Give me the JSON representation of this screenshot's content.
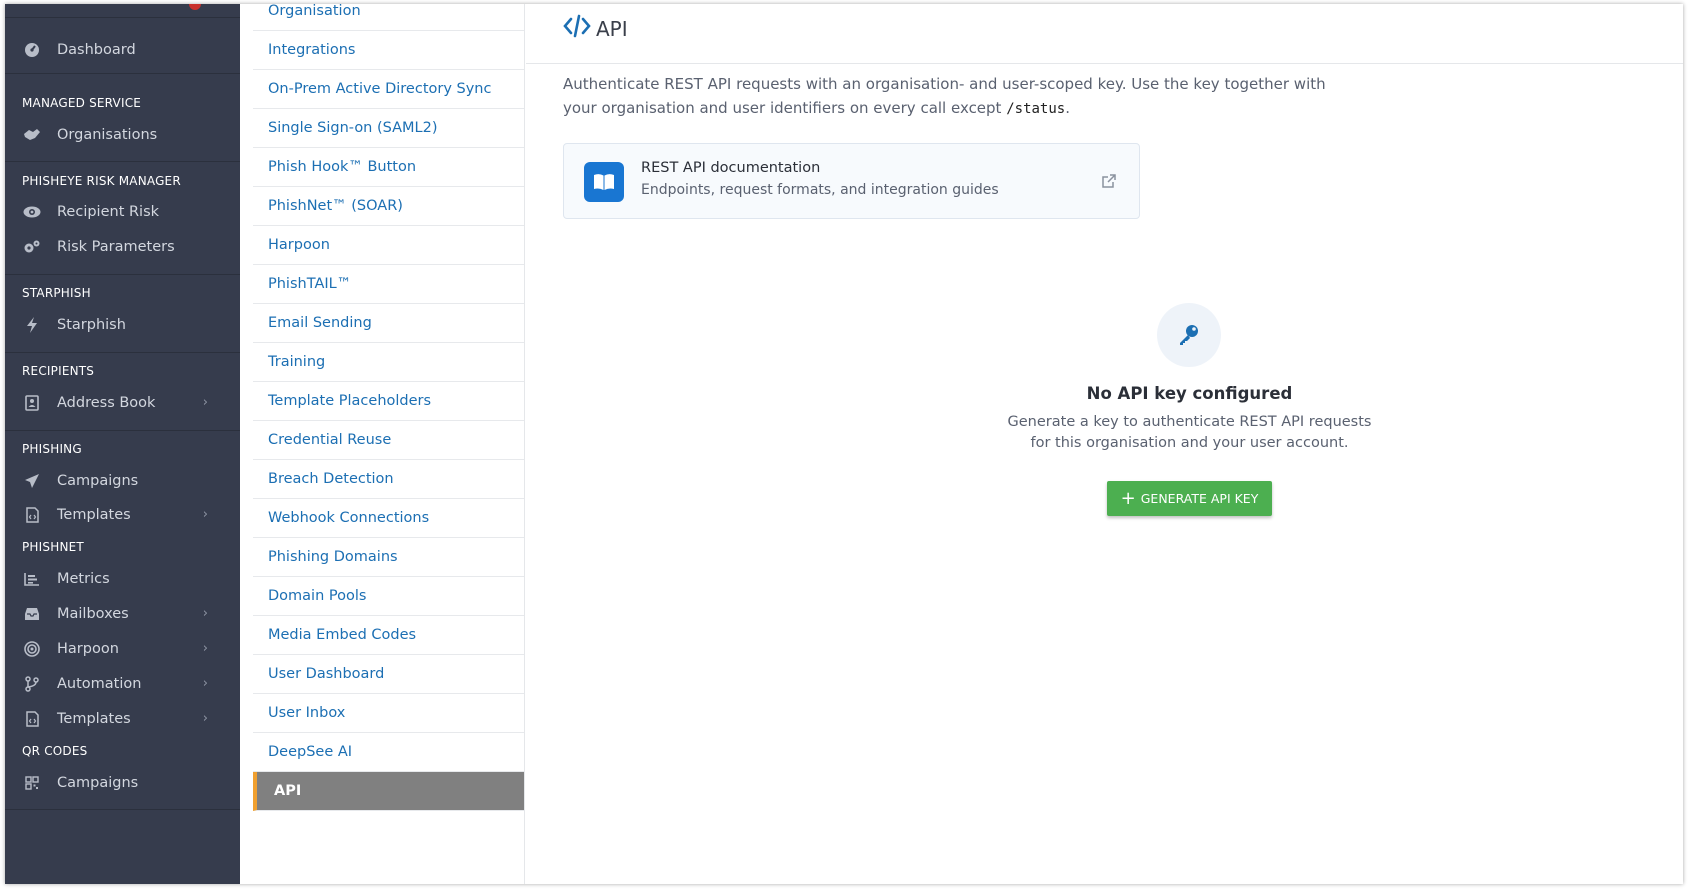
{
  "nav": {
    "dashboard": "Dashboard",
    "sections": {
      "managed_service": "MANAGED SERVICE",
      "risk_manager": "PHISHEYE RISK MANAGER",
      "starphish": "STARPHISH",
      "recipients": "RECIPIENTS",
      "phishing": "PHISHING",
      "phishnet": "PHISHNET",
      "qr_codes": "QR CODES"
    },
    "items": {
      "organisations": "Organisations",
      "recipient_risk": "Recipient Risk",
      "risk_parameters": "Risk Parameters",
      "starphish": "Starphish",
      "address_book": "Address Book",
      "campaigns": "Campaigns",
      "templates": "Templates",
      "metrics": "Metrics",
      "mailboxes": "Mailboxes",
      "harpoon": "Harpoon",
      "automation": "Automation",
      "templates2": "Templates",
      "qr_campaigns": "Campaigns"
    },
    "chevron": "›"
  },
  "settings": {
    "items": [
      "Organisation",
      "Integrations",
      "On-Prem Active Directory Sync",
      "Single Sign-on (SAML2)",
      "Phish Hook™ Button",
      "PhishNet™ (SOAR)",
      "Harpoon",
      "PhishTAIL™",
      "Email Sending",
      "Training",
      "Template Placeholders",
      "Credential Reuse",
      "Breach Detection",
      "Webhook Connections",
      "Phishing Domains",
      "Domain Pools",
      "Media Embed Codes",
      "User Dashboard",
      "User Inbox",
      "DeepSee AI",
      "API"
    ],
    "active": "API"
  },
  "main": {
    "title": "API",
    "description_text": "Authenticate REST API requests with an organisation- and user-scoped key. Use the key together with your organisation and user identifiers on every call except ",
    "description_code": "/status",
    "description_end": ".",
    "doc_card": {
      "title": "REST API documentation",
      "subtitle": "Endpoints, request formats, and integration guides"
    },
    "empty_state": {
      "title": "No API key configured",
      "description": "Generate a key to authenticate REST API requests for this organisation and your user account.",
      "button_label": "GENERATE API KEY",
      "button_prefix": "+"
    }
  },
  "colors": {
    "nav_bg": "#363c4d",
    "link": "#1c6fb3",
    "active_bg": "#808080",
    "active_accent": "#f0a030",
    "primary": "#1976d2",
    "success": "#4caf50"
  }
}
